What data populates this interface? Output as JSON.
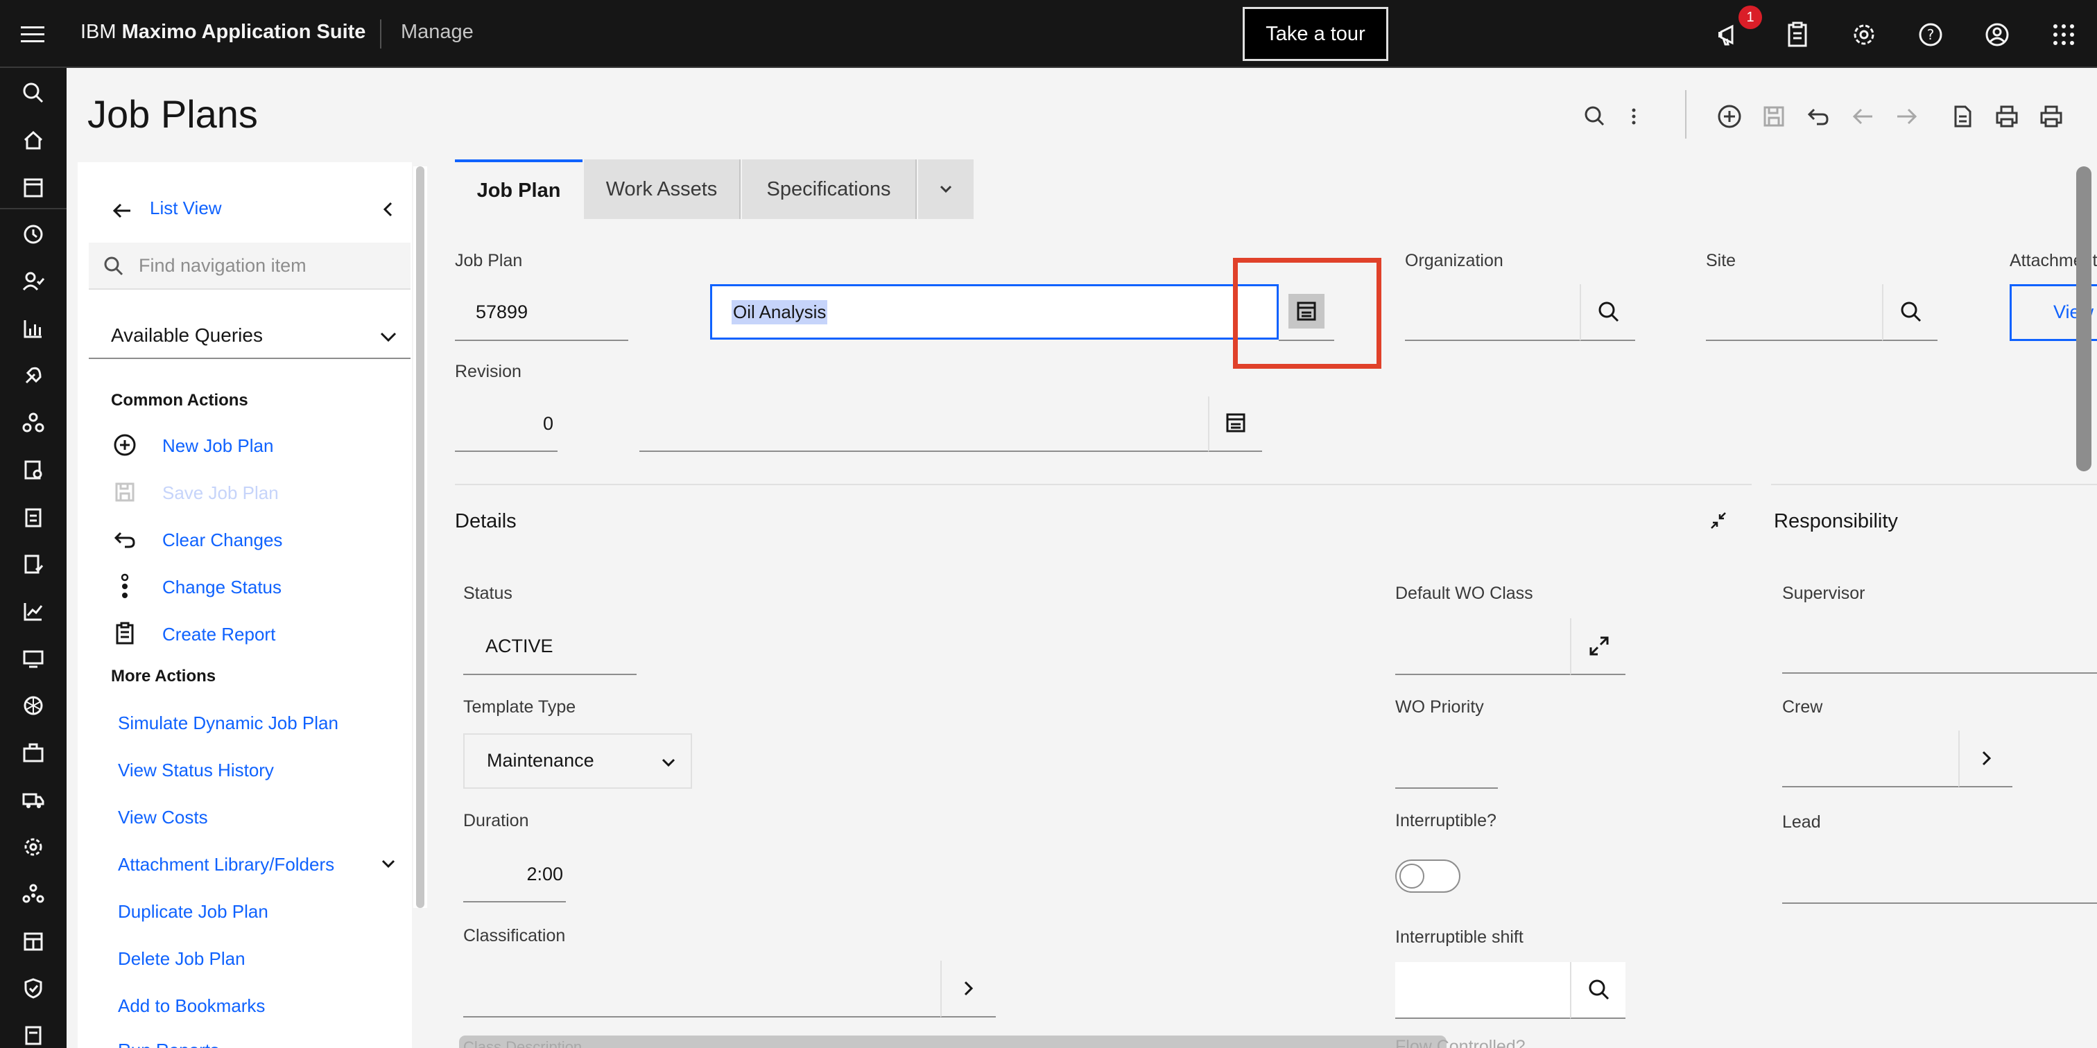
{
  "header": {
    "brand_prefix": "IBM",
    "brand_name": "Maximo Application Suite",
    "product": "Manage",
    "tour_button": "Take a tour",
    "notification_count": "1"
  },
  "page": {
    "title": "Job Plans"
  },
  "sidenav": {
    "list_view": "List View",
    "search_placeholder": "Find navigation item",
    "queries_label": "Available Queries",
    "common_actions_header": "Common Actions",
    "common_actions": [
      {
        "label": "New Job Plan",
        "icon": "add-circle-icon"
      },
      {
        "label": "Save Job Plan",
        "icon": "save-icon",
        "disabled": true
      },
      {
        "label": "Clear Changes",
        "icon": "undo-icon"
      },
      {
        "label": "Change Status",
        "icon": "status-icon"
      },
      {
        "label": "Create Report",
        "icon": "report-icon"
      }
    ],
    "more_actions_header": "More Actions",
    "more_actions": [
      "Simulate Dynamic Job Plan",
      "View Status History",
      "View Costs",
      "Attachment Library/Folders",
      "Duplicate Job Plan",
      "Delete Job Plan",
      "Add to Bookmarks",
      "Run Reports"
    ]
  },
  "tabs": [
    "Job Plan",
    "Work Assets",
    "Specifications"
  ],
  "form": {
    "jobplan_label": "Job Plan",
    "jobplan_value": "57899",
    "description_value": "Oil Analysis",
    "organization_label": "Organization",
    "organization_value": "",
    "site_label": "Site",
    "site_value": "",
    "attachments_label": "Attachments",
    "attachments_button": "View",
    "revision_label": "Revision",
    "revision_value": "0",
    "revision_desc_value": ""
  },
  "details": {
    "section_title": "Details",
    "status_label": "Status",
    "status_value": "ACTIVE",
    "template_type_label": "Template Type",
    "template_type_value": "Maintenance",
    "duration_label": "Duration",
    "duration_value": "2:00",
    "classification_label": "Classification",
    "classification_value": "",
    "class_description_label": "Class Description",
    "default_wo_class_label": "Default WO Class",
    "wo_priority_label": "WO Priority",
    "interruptible_label": "Interruptible?",
    "interruptible_on": false,
    "interruptible_shift_label": "Interruptible shift",
    "flow_controlled_label": "Flow Controlled?"
  },
  "responsibility": {
    "section_title": "Responsibility",
    "supervisor_label": "Supervisor",
    "crew_label": "Crew",
    "lead_label": "Lead"
  },
  "colors": {
    "accent": "#0f62fe",
    "highlight_box": "#e0412a",
    "topbar": "#161616",
    "badge": "#da1e28"
  }
}
